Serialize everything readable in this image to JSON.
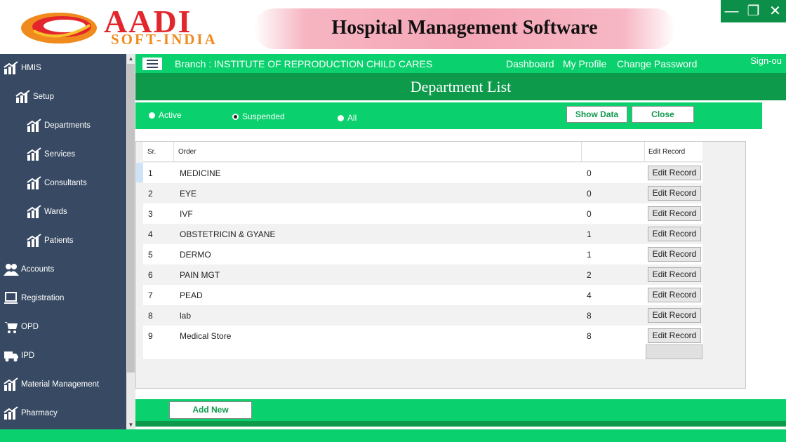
{
  "banner": {
    "logo_main": "AADI",
    "logo_sub": "SOFT-INDIA",
    "title": "Hospital Management Software"
  },
  "window": {
    "minimize": "—",
    "restore": "❐",
    "close": "✕"
  },
  "sidebar": {
    "items": [
      {
        "label": "HMIS",
        "icon": "chart-icon"
      },
      {
        "label": "Setup",
        "icon": "chart-icon"
      },
      {
        "label": "Departments",
        "icon": "chart-icon"
      },
      {
        "label": "Services",
        "icon": "chart-icon"
      },
      {
        "label": "Consultants",
        "icon": "chart-icon"
      },
      {
        "label": "Wards",
        "icon": "chart-icon"
      },
      {
        "label": "Patients",
        "icon": "chart-icon"
      },
      {
        "label": "Accounts",
        "icon": "users-icon"
      },
      {
        "label": "Registration",
        "icon": "monitor-icon"
      },
      {
        "label": "OPD",
        "icon": "cart-icon"
      },
      {
        "label": "IPD",
        "icon": "truck-icon"
      },
      {
        "label": "Material Management",
        "icon": "chart-icon"
      },
      {
        "label": "Pharmacy",
        "icon": "chart-icon"
      }
    ]
  },
  "topnav": {
    "branch": "Branch : INSTITUTE OF REPRODUCTION  CHILD CARES",
    "dashboard": "Dashboard",
    "my_profile": "My Profile",
    "change_password": "Change Password",
    "sign_out": "Sign-ou"
  },
  "page": {
    "title": "Department List"
  },
  "filters": {
    "active": "Active",
    "suspended": "Suspended",
    "all": "All",
    "selected": "Suspended",
    "show_data": "Show Data",
    "close": "Close"
  },
  "grid": {
    "headers": {
      "sr": "Sr.",
      "order": "Order",
      "blank": "",
      "edit": "Edit Record"
    },
    "edit_label": "Edit Record",
    "rows": [
      {
        "sr": "1",
        "name": "MEDICINE",
        "order": "0"
      },
      {
        "sr": "2",
        "name": "EYE",
        "order": "0"
      },
      {
        "sr": "3",
        "name": "IVF",
        "order": "0"
      },
      {
        "sr": "4",
        "name": "OBSTETRICIN & GYANE",
        "order": "1"
      },
      {
        "sr": "5",
        "name": "DERMO",
        "order": "1"
      },
      {
        "sr": "6",
        "name": "PAIN MGT",
        "order": "2"
      },
      {
        "sr": "7",
        "name": "PEAD",
        "order": "4"
      },
      {
        "sr": "8",
        "name": "lab",
        "order": "8"
      },
      {
        "sr": "9",
        "name": "Medical Store",
        "order": "8"
      }
    ]
  },
  "footer": {
    "add_new": "Add New"
  },
  "colors": {
    "sidebar": "#384a63",
    "accent_green": "#0ad16d",
    "dark_green": "#0d9a4b",
    "logo_red": "#e3262d",
    "logo_orange": "#f08a1c"
  }
}
